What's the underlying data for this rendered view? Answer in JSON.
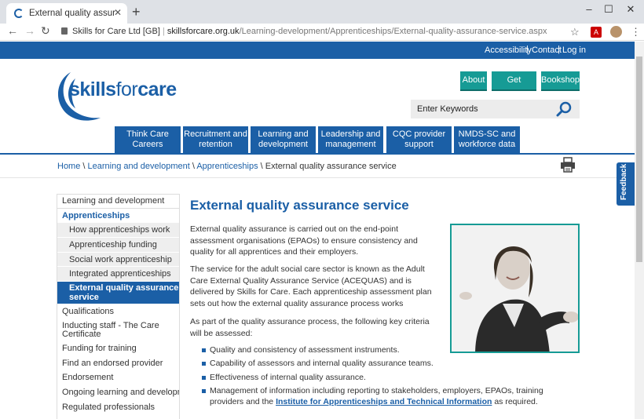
{
  "browser": {
    "tab_title": "External quality assurance service",
    "tab_close": "✕",
    "new_tab": "+",
    "url_host": "Skills for Care Ltd [GB]",
    "url_domain": "skillsforcare.org.uk",
    "url_path": "/Learning-development/Apprenticeships/External-quality-assurance-service.aspx",
    "window_controls": [
      "–",
      "☐",
      "✕"
    ]
  },
  "utility": {
    "accessibility": "Accessibility",
    "contact": "Contact",
    "login": "Log in"
  },
  "logo": {
    "bold": "skills",
    "light": "for",
    "bold2": "care"
  },
  "header_buttons": [
    "About",
    "Get involved",
    "Bookshop"
  ],
  "search": {
    "placeholder": "Enter Keywords"
  },
  "main_nav": [
    "Think Care Careers",
    "Recruitment and retention",
    "Learning and development",
    "Leadership and management",
    "CQC provider support",
    "NMDS-SC and workforce data"
  ],
  "breadcrumb": {
    "home": "Home",
    "sep": " \\ ",
    "learning": "Learning and development",
    "apprenticeships": "Apprenticeships",
    "current": "External quality assurance service"
  },
  "sidebar": {
    "section": "Learning and development",
    "apprenticeships": "Apprenticeships",
    "sub_items": [
      "How apprenticeships work",
      "Apprenticeship funding",
      "Social work apprenticeship",
      "Integrated apprenticeships"
    ],
    "active": "External quality assurance service",
    "items": [
      "Qualifications",
      "Inducting staff - The Care Certificate",
      "Funding for training",
      "Find an endorsed provider",
      "Endorsement",
      "Ongoing learning and development",
      "Regulated professionals"
    ]
  },
  "content": {
    "title": "External quality assurance service",
    "p1": "External quality assurance is carried out on the end-point assessment organisations (EPAOs) to ensure consistency and quality for all apprentices and their employers.",
    "p2": "The service for the adult social care sector is known as the Adult Care External Quality Assurance Service (ACEQUAS) and is delivered by Skills for Care. Each apprenticeship assessment plan sets out how the external quality assurance process works",
    "p3": "As part of the quality assurance process, the following key criteria will be assessed:",
    "bullets": [
      "Quality and consistency of assessment instruments.",
      "Capability of assessors and internal quality assurance teams.",
      "Effectiveness of internal quality assurance."
    ],
    "bullet4_pre": "Management of information including reporting to stakeholders, employers, EPAOs, training providers and the",
    "bullet4_link": "Institute for Apprenticeships and Technical Information",
    "bullet4_post": " as required."
  },
  "feedback": "Feedback",
  "colors": {
    "brand_blue": "#1b5fa6",
    "teal": "#169b95"
  }
}
